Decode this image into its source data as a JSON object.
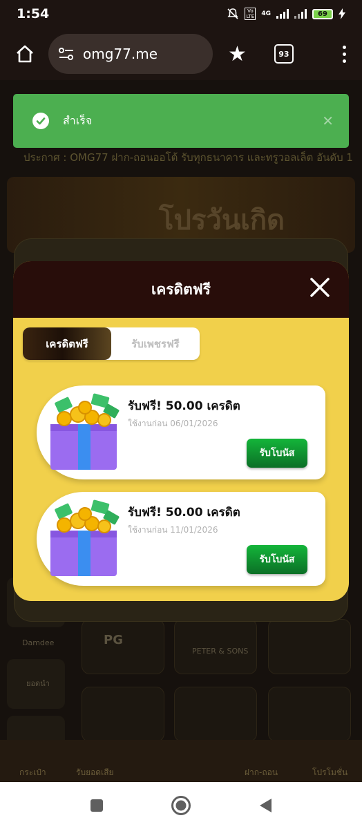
{
  "status_bar": {
    "time": "1:54",
    "network": "4G",
    "volte": "Vo LTE",
    "battery": "69"
  },
  "browser": {
    "url": "omg77.me",
    "tab_count": "93"
  },
  "background": {
    "marquee": "ประกาศ : OMG77 ฝาก-ถอนออโต้ รับทุกธนาคาร และทรูวอลเล็ต อันดับ 1",
    "promo_title": "โปรวันเกิด",
    "labels": {
      "side_1": "Damdee",
      "side_2": "ยอดนำ",
      "game_1": "PG",
      "game_2": "PETER & SONS"
    },
    "nav": [
      "กระเป๋า",
      "รับยอดเสีย",
      "ฝาก-ถอน",
      "โปรโมชั่น"
    ]
  },
  "toast": {
    "message": "สำเร็จ"
  },
  "modal": {
    "title": "เครดิตฟรี",
    "tabs": [
      {
        "label": "เครดิตฟรี",
        "active": true
      },
      {
        "label": "รับเพชรฟรี",
        "active": false
      }
    ],
    "bonuses": [
      {
        "title": "รับฟรี! 50.00 เครดิต",
        "expiry": "ใช้งานก่อน 06/01/2026",
        "button": "รับโบนัส"
      },
      {
        "title": "รับฟรี! 50.00 เครดิต",
        "expiry": "ใช้งานก่อน 11/01/2026",
        "button": "รับโบนัส"
      }
    ]
  },
  "colors": {
    "toast_green": "#4caf50",
    "modal_header": "#280d0a",
    "modal_body": "#f1d04b",
    "claim_green": "#14b53a",
    "gift_purple": "#9b6cf0",
    "gift_ribbon": "#3b8ef0"
  },
  "icons": {
    "status": [
      "mute-icon",
      "signal-icon",
      "battery-icon",
      "charging-icon"
    ],
    "browser": [
      "home-icon",
      "site-settings-icon",
      "star-icon",
      "tabs-icon",
      "more-menu-icon"
    ],
    "toast": [
      "check-circle-icon",
      "close-icon"
    ],
    "modal": [
      "close-icon",
      "gift-box-icon"
    ],
    "android": [
      "recents-icon",
      "home-circle-icon",
      "back-icon"
    ]
  }
}
